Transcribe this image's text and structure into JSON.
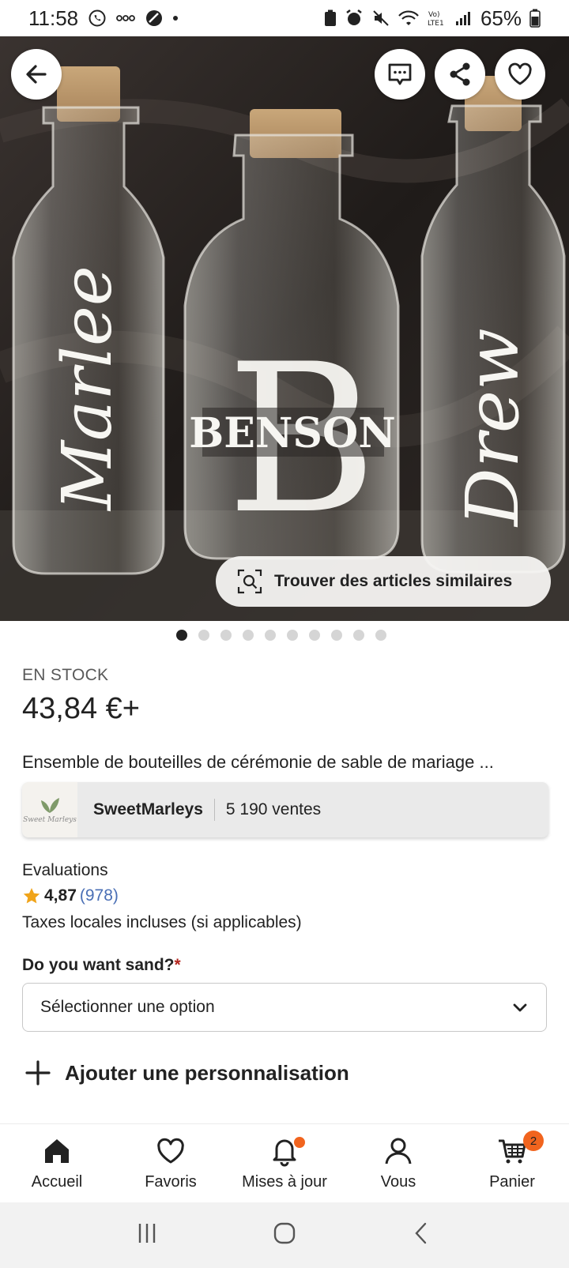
{
  "status_bar": {
    "time": "11:58",
    "battery": "65%"
  },
  "hero": {
    "bottle_left_text": "Marlee",
    "bottle_center_text": "BENSON",
    "bottle_center_monogram": "B",
    "bottle_right_text": "Drew",
    "find_similar_label": "Trouver des articles similaires",
    "image_count": 10,
    "active_image_index": 0
  },
  "listing": {
    "stock_label": "EN STOCK",
    "price": "43,84 €+",
    "title": "Ensemble de bouteilles de cérémonie de sable de mariage ...",
    "shop": {
      "logo_text": "Sweet Marleys",
      "name": "SweetMarleys",
      "sales": "5 190 ventes"
    },
    "ratings_label": "Evaluations",
    "rating_value": "4,87",
    "rating_count": "(978)",
    "taxes_note": "Taxes locales incluses (si applicables)",
    "option_label": "Do you want sand?",
    "option_required_mark": "*",
    "option_placeholder": "Sélectionner une option",
    "add_personalization": "Ajouter une personnalisation"
  },
  "bottom_nav": {
    "items": [
      {
        "label": "Accueil",
        "icon": "home-icon"
      },
      {
        "label": "Favoris",
        "icon": "heart-icon"
      },
      {
        "label": "Mises à jour",
        "icon": "bell-icon"
      },
      {
        "label": "Vous",
        "icon": "person-icon"
      },
      {
        "label": "Panier",
        "icon": "cart-icon"
      }
    ],
    "cart_badge": "2"
  },
  "colors": {
    "accent_orange": "#f1641e",
    "star": "#f0a41a",
    "link_blue": "#4a6fb5"
  }
}
